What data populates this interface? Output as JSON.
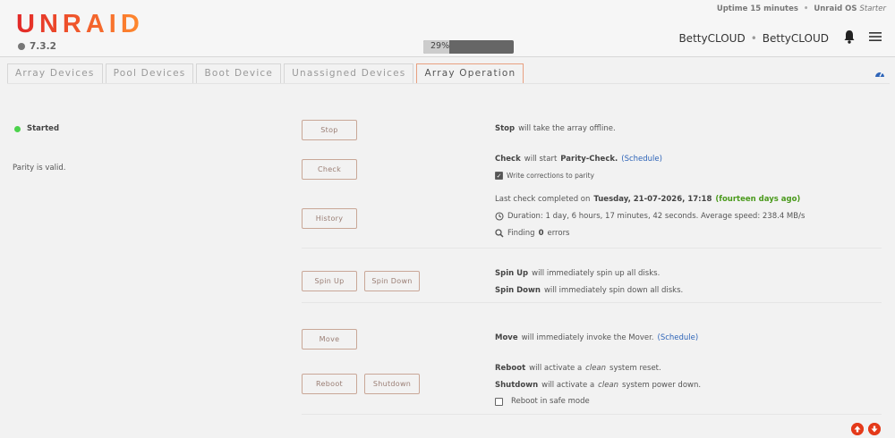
{
  "header": {
    "logo": "UNRAID",
    "version": "7.3.2",
    "progress": {
      "label": "29%",
      "value": 0.29
    },
    "uptime": "Uptime 15 minutes",
    "os_label": "Unraid OS",
    "os_edition": "Starter",
    "server_name": "BettyCLOUD",
    "server_desc": "BettyCLOUD"
  },
  "tabs": [
    {
      "label": "Array Devices"
    },
    {
      "label": "Pool Devices"
    },
    {
      "label": "Boot Device"
    },
    {
      "label": "Unassigned Devices"
    },
    {
      "label": "Array Operation"
    }
  ],
  "array": {
    "status": "Started",
    "status_color": "#4cd24c",
    "parity_status": "Parity is valid."
  },
  "buttons": {
    "stop": "Stop",
    "check": "Check",
    "history": "History",
    "spin_up": "Spin Up",
    "spin_down": "Spin Down",
    "move": "Move",
    "reboot": "Reboot",
    "shutdown": "Shutdown"
  },
  "descriptions": {
    "stop_bold": "Stop",
    "stop_text": "will take the array offline.",
    "check_bold": "Check",
    "check_text": "will start",
    "check_bold2": "Parity-Check.",
    "check_link": "(Schedule)",
    "write_corrections": "Write corrections to parity",
    "last_check_prefix": "Last check completed on",
    "last_check_date": "Tuesday, 21-07-2026, 17:18",
    "last_check_ago": "(fourteen days ago)",
    "duration": "Duration: 1 day, 6 hours, 17 minutes, 42 seconds. Average speed: 238.4 MB/s",
    "finding_prefix": "Finding",
    "finding_count": "0",
    "finding_suffix": "errors",
    "spin_up_bold": "Spin Up",
    "spin_up_text": "will immediately spin up all disks.",
    "spin_down_bold": "Spin Down",
    "spin_down_text": "will immediately spin down all disks.",
    "move_bold": "Move",
    "move_text": "will immediately invoke the Mover.",
    "move_link": "(Schedule)",
    "reboot_bold": "Reboot",
    "reboot_text1": "will activate a",
    "reboot_clean": "clean",
    "reboot_text2": "system reset.",
    "shutdown_bold": "Shutdown",
    "shutdown_text1": "will activate a",
    "shutdown_clean": "clean",
    "shutdown_text2": "system power down.",
    "safe_mode": "Reboot in safe mode"
  },
  "colors": {
    "accent": "#e8581c",
    "link": "#2f65b8",
    "success": "#4a9a1c",
    "scroll_buttons": "#e43a1a"
  },
  "write_corrections_checked": true,
  "safe_mode_checked": false
}
